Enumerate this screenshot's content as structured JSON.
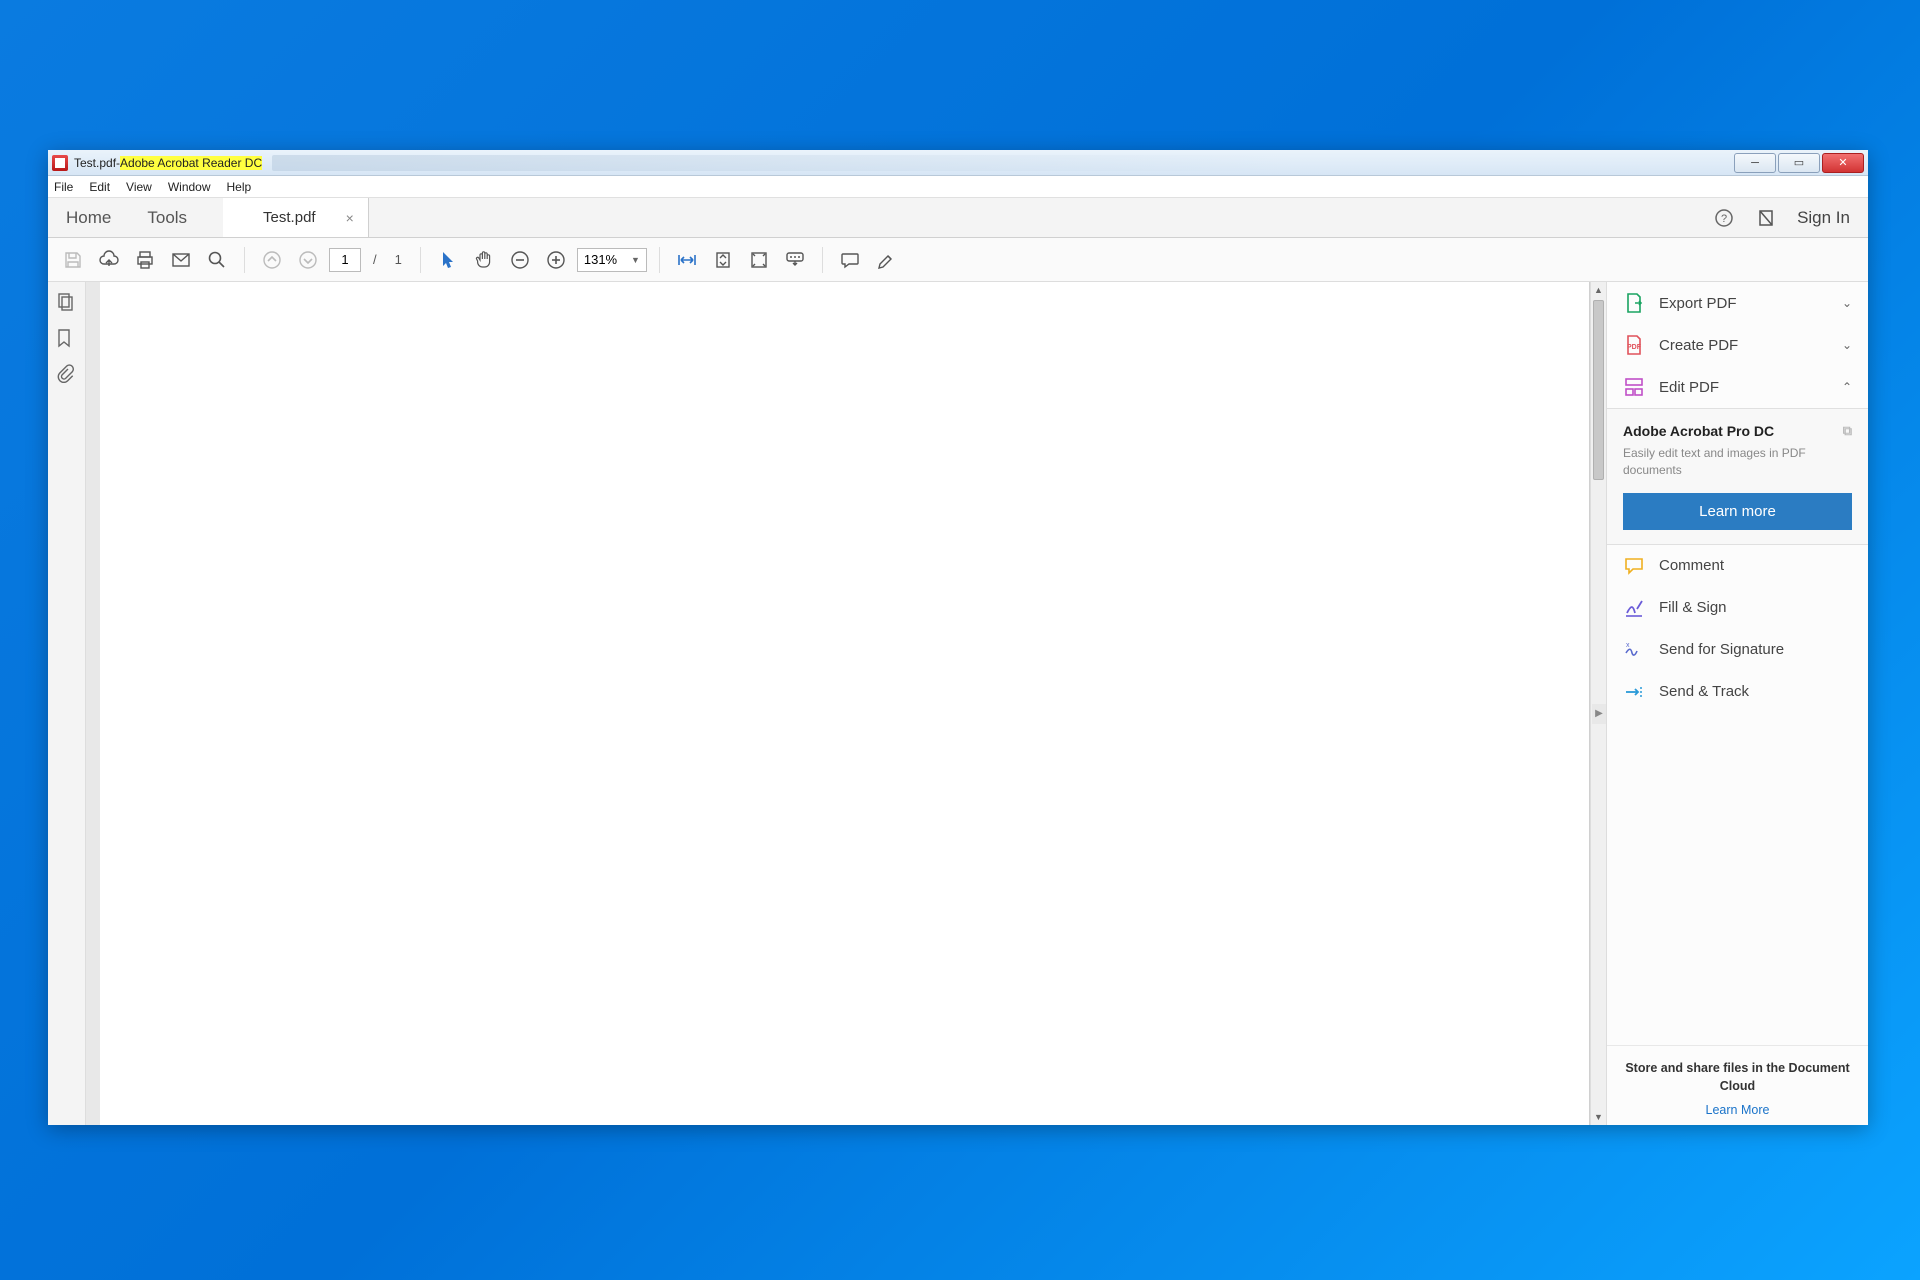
{
  "titlebar": {
    "filename": "Test.pdf",
    "separator": " - ",
    "app_name": "Adobe Acrobat Reader DC"
  },
  "menubar": [
    "File",
    "Edit",
    "View",
    "Window",
    "Help"
  ],
  "tabbar": {
    "home": "Home",
    "tools": "Tools",
    "active_doc": "Test.pdf",
    "signin": "Sign In"
  },
  "toolbar": {
    "page_current": "1",
    "page_sep": "/",
    "page_total": "1",
    "zoom": "131%"
  },
  "right_pane": {
    "tools_top": [
      {
        "label": "Export PDF",
        "color": "#1aa361",
        "expanded": false
      },
      {
        "label": "Create PDF",
        "color": "#e0525b",
        "expanded": false
      },
      {
        "label": "Edit PDF",
        "color": "#c050c8",
        "expanded": true
      }
    ],
    "promo": {
      "title": "Adobe Acrobat Pro DC",
      "desc": "Easily edit text and images in PDF documents",
      "button": "Learn more"
    },
    "tools_bottom": [
      {
        "label": "Comment",
        "color": "#f0b020"
      },
      {
        "label": "Fill & Sign",
        "color": "#6a5bd8"
      },
      {
        "label": "Send for Signature",
        "color": "#5a6bce"
      },
      {
        "label": "Send & Track",
        "color": "#2a9ad8"
      }
    ],
    "footer": {
      "title": "Store and share files in the Document Cloud",
      "link": "Learn More"
    }
  }
}
